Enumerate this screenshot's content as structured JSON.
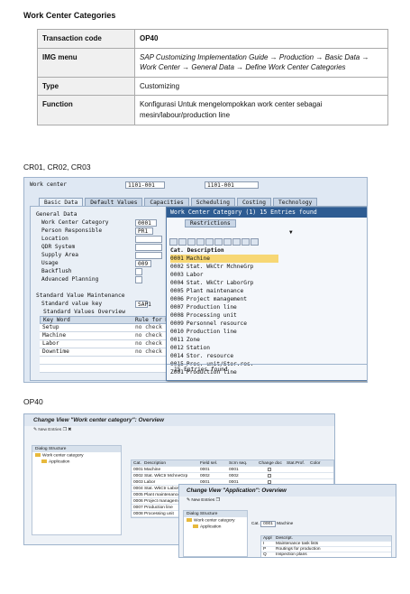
{
  "title": "Work Center Categories",
  "info_table": [
    {
      "key": "Transaction code",
      "value": "OP40"
    },
    {
      "key": "IMG menu",
      "value": "SAP Customizing Implementation Guide → Production → Basic Data → Work Center → General Data →  Define Work Center Categories"
    },
    {
      "key": "Type",
      "value": "Customizing"
    },
    {
      "key": "Function",
      "value": "Konfigurasi Untuk mengelompokkan work center sebagai mesin/labour/production line"
    }
  ],
  "caption1": "CR01, CR02, CR03",
  "caption2": "OP40",
  "sap1": {
    "wc_label": "Work center",
    "wc_value": "1101-001",
    "wc_value2": "1101-001",
    "tabs": [
      "Basic Data",
      "Default Values",
      "Capacities",
      "Scheduling",
      "Costing",
      "Technology"
    ],
    "general_data": "General Data",
    "fields": [
      {
        "label": "Work Center Category",
        "value": "0001"
      },
      {
        "label": "Person Responsible",
        "value": "PR1"
      },
      {
        "label": "Location",
        "value": ""
      },
      {
        "label": "QDR System",
        "value": ""
      },
      {
        "label": "Supply Area",
        "value": ""
      },
      {
        "label": "Usage",
        "value": "009"
      },
      {
        "label": "Backflush",
        "value": ""
      },
      {
        "label": "Advanced Planning",
        "value": ""
      }
    ],
    "svm": "Standard Value Maintenance",
    "svk_label": "Standard value key",
    "svk_value": "SAP1",
    "svo": "Standard Values Overview",
    "grid_head": [
      "Key Word",
      "Rule for Ma"
    ],
    "grid_rows": [
      {
        "k": "Setup",
        "r": "no check"
      },
      {
        "k": "Machine",
        "r": "no check"
      },
      {
        "k": "Labor",
        "r": "no check"
      },
      {
        "k": "Downtime",
        "r": "no check"
      }
    ],
    "popup": {
      "title": "Work Center Category (1)  15 Entries found",
      "tab": "Restrictions",
      "head_cat": "Cat.",
      "head_desc": "Description",
      "entries": [
        {
          "cat": "0001",
          "desc": "Machine"
        },
        {
          "cat": "0002",
          "desc": "Stat. WkCtr MchneGrp"
        },
        {
          "cat": "0003",
          "desc": "Labor"
        },
        {
          "cat": "0004",
          "desc": "Stat. WkCtr LaborGrp"
        },
        {
          "cat": "0005",
          "desc": "Plant maintenance"
        },
        {
          "cat": "0006",
          "desc": "Project management"
        },
        {
          "cat": "0007",
          "desc": "Production line"
        },
        {
          "cat": "0008",
          "desc": "Processing unit"
        },
        {
          "cat": "0009",
          "desc": "Personnel resource"
        },
        {
          "cat": "0010",
          "desc": "Production line"
        },
        {
          "cat": "0011",
          "desc": "Zone"
        },
        {
          "cat": "0012",
          "desc": "Station"
        },
        {
          "cat": "0014",
          "desc": "Stor. resource"
        },
        {
          "cat": "0015",
          "desc": "Proc. unit/Stor.res."
        },
        {
          "cat": "Z001",
          "desc": "Production line"
        }
      ],
      "footer": "15 Entries found"
    }
  },
  "op1": {
    "title": "Change View \"Work center category\": Overview",
    "toolbar": "New Entries",
    "tree_title": "Dialog Structure",
    "tree_item1": "Work center category",
    "tree_item2": "Application",
    "cols": [
      "Cat.",
      "Description",
      "Field sel.",
      "Scrn seq.",
      "Change doc",
      "Stat.Prof.",
      "Color"
    ],
    "rows": [
      [
        "0001",
        "Machine",
        "0001",
        "0001"
      ],
      [
        "0002",
        "Stat. WkCtr MchneGrp",
        "0002",
        "0002"
      ],
      [
        "0003",
        "Labor",
        "0001",
        "0001"
      ],
      [
        "0004",
        "Stat. WkCtr LaborGrp",
        "",
        ""
      ],
      [
        "0005",
        "Plant maintenance",
        "",
        ""
      ],
      [
        "0006",
        "Project management",
        "",
        ""
      ],
      [
        "0007",
        "Production line",
        "",
        ""
      ],
      [
        "0008",
        "Processing unit",
        "",
        ""
      ]
    ]
  },
  "op2": {
    "title": "Change View \"Application\": Overview",
    "toolbar": "New Entries",
    "tree_title": "Dialog Structure",
    "tree_item1": "Work center category",
    "tree_item2": "Application",
    "cat_label": "Cat.",
    "cat_value": "0001",
    "cat_desc": "Machine",
    "cols": [
      "Appl",
      "Descript."
    ],
    "rows": [
      [
        "I",
        "Maintenance task lists"
      ],
      [
        "P",
        "Routings for production"
      ],
      [
        "Q",
        "Inspection plans"
      ]
    ]
  }
}
